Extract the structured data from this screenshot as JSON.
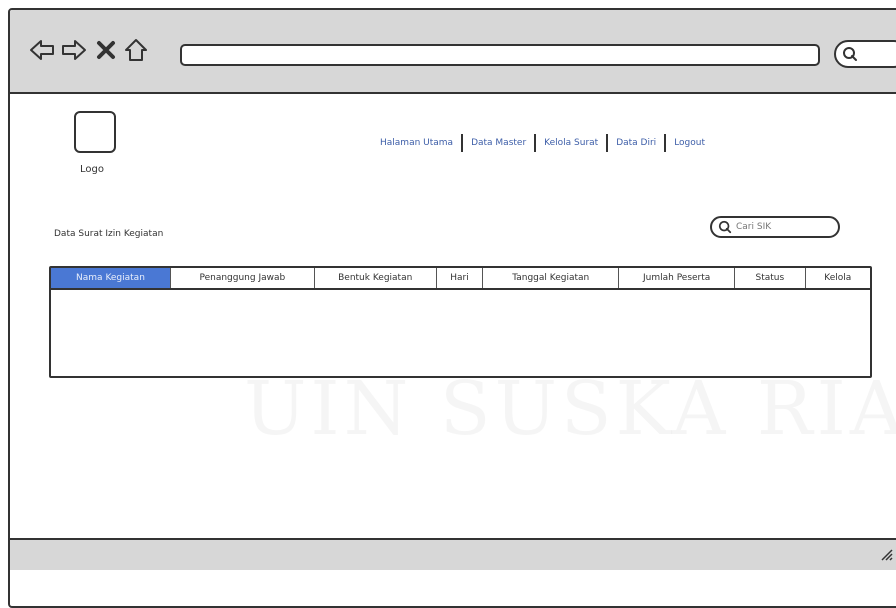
{
  "nav": {
    "items": [
      {
        "label": "Halaman Utama"
      },
      {
        "label": "Data Master"
      },
      {
        "label": "Kelola Surat"
      },
      {
        "label": "Data Diri"
      },
      {
        "label": "Logout"
      }
    ]
  },
  "logo": {
    "label": "Logo"
  },
  "page": {
    "title": "Data Surat Izin Kegiatan"
  },
  "search": {
    "placeholder": "Cari SIK"
  },
  "table": {
    "columns": [
      {
        "label": "Nama Kegiatan",
        "active": true
      },
      {
        "label": "Penanggung Jawab",
        "active": false
      },
      {
        "label": "Bentuk Kegiatan",
        "active": false
      },
      {
        "label": "Hari",
        "active": false
      },
      {
        "label": "Tanggal Kegiatan",
        "active": false
      },
      {
        "label": "Jumlah Peserta",
        "active": false
      },
      {
        "label": "Status",
        "active": false
      },
      {
        "label": "Kelola",
        "active": false
      }
    ]
  },
  "watermark": {
    "text": "UIN SUSKA RIAU"
  },
  "colors": {
    "accent": "#4a78d4",
    "link": "#3d5ea8",
    "chrome": "#d7d7d7"
  }
}
